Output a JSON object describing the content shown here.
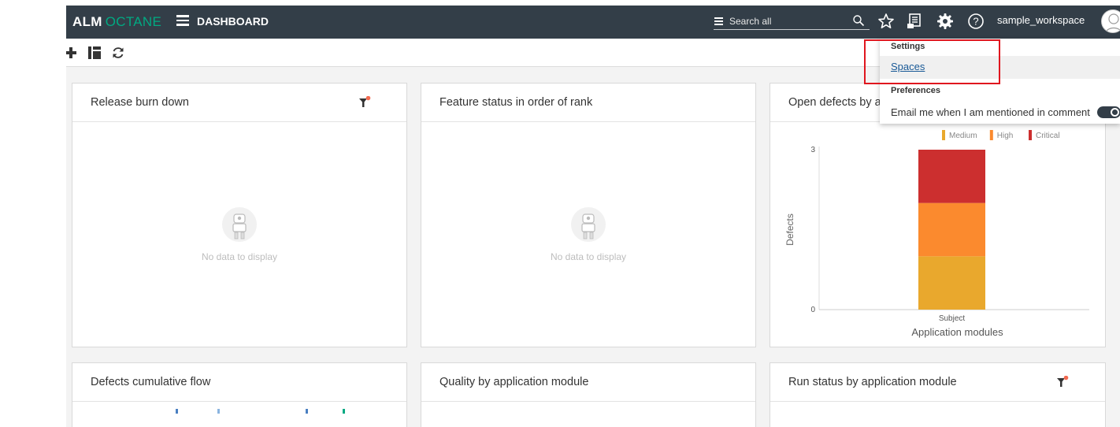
{
  "topbar": {
    "brand_part1": "ALM",
    "brand_part2": "OCTANE",
    "page_title": "DASHBOARD",
    "search_placeholder": "Search all",
    "username": "sample_workspace"
  },
  "widgets": [
    {
      "title": "Release burn down",
      "empty_text": "No data to display"
    },
    {
      "title": "Feature status in order of rank",
      "empty_text": "No data to display"
    },
    {
      "title": "Open defects by a"
    },
    {
      "title": "Defects cumulative flow"
    },
    {
      "title": "Quality by application module"
    },
    {
      "title": "Run status by application module"
    }
  ],
  "chart_data": {
    "type": "bar",
    "stacked": true,
    "categories": [
      "Subject"
    ],
    "series": [
      {
        "name": "Medium",
        "values": [
          1
        ],
        "color": "#e9a82d"
      },
      {
        "name": "High",
        "values": [
          1
        ],
        "color": "#fb8a2e"
      },
      {
        "name": "Critical",
        "values": [
          1
        ],
        "color": "#cc2f2f"
      }
    ],
    "ylabel": "Defects",
    "xlabel": "Application modules",
    "ylim": [
      0,
      3
    ],
    "yticks": [
      "0",
      "3"
    ],
    "legend_position": "top-right"
  },
  "dropdown": {
    "settings_heading": "Settings",
    "spaces_link": "Spaces",
    "preferences_heading": "Preferences",
    "email_pref": "Email me when I am mentioned in comment"
  },
  "colors": {
    "topbar": "#333e48",
    "brand_accent": "#01a982",
    "highlight": "#e0161e"
  }
}
